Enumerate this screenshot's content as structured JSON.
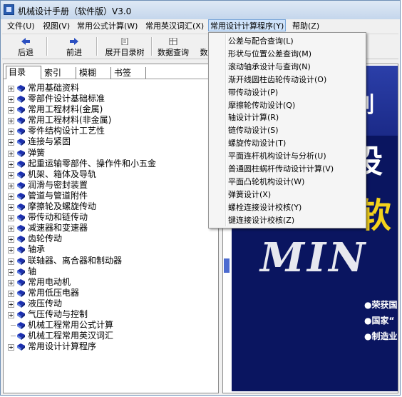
{
  "window": {
    "title": "机械设计手册（软件版）V3.0"
  },
  "menubar": {
    "items": [
      {
        "label": "文件(U)"
      },
      {
        "label": "视图(V)"
      },
      {
        "label": "常用公式计算(W)"
      },
      {
        "label": "常用英汉词汇(X)"
      },
      {
        "label": "常用设计计算程序(Y)"
      },
      {
        "label": "帮助(Z)"
      }
    ]
  },
  "toolbar": {
    "back_label": "后退",
    "forward_label": "前进",
    "expand_label": "展开目录树",
    "query_label": "数据查询",
    "more_label": "数"
  },
  "left_panel": {
    "tabs": [
      {
        "label": "目录"
      },
      {
        "label": "索引"
      },
      {
        "label": "模糊"
      },
      {
        "label": "书签"
      }
    ],
    "tree": [
      {
        "label": "常用基础资料",
        "expandable": true
      },
      {
        "label": "零部件设计基础标准",
        "expandable": true
      },
      {
        "label": "常用工程材料(金属)",
        "expandable": true
      },
      {
        "label": "常用工程材料(非金属)",
        "expandable": true
      },
      {
        "label": "零件结构设计工艺性",
        "expandable": true
      },
      {
        "label": "连接与紧固",
        "expandable": true
      },
      {
        "label": "弹簧",
        "expandable": true
      },
      {
        "label": "起重运输零部件、操作件和小五金",
        "expandable": true
      },
      {
        "label": "机架、箱体及导轨",
        "expandable": true
      },
      {
        "label": "润滑与密封装置",
        "expandable": true
      },
      {
        "label": "管道与管道附件",
        "expandable": true
      },
      {
        "label": "摩擦轮及螺旋传动",
        "expandable": true
      },
      {
        "label": "带传动和链传动",
        "expandable": true
      },
      {
        "label": "减速器和变速器",
        "expandable": true
      },
      {
        "label": "齿轮传动",
        "expandable": true
      },
      {
        "label": "轴承",
        "expandable": true
      },
      {
        "label": "联轴器、离合器和制动器",
        "expandable": true
      },
      {
        "label": "轴",
        "expandable": true
      },
      {
        "label": "常用电动机",
        "expandable": true
      },
      {
        "label": "常用低压电器",
        "expandable": true
      },
      {
        "label": "液压传动",
        "expandable": true
      },
      {
        "label": "气压传动与控制",
        "expandable": true
      },
      {
        "label": "机械工程常用公式计算",
        "expandable": false
      },
      {
        "label": "机械工程常用英汉词汇",
        "expandable": false
      },
      {
        "label": "常用设计计算程序",
        "expandable": true
      }
    ]
  },
  "dropdown": {
    "items": [
      {
        "label": "公差与配合查询(L)"
      },
      {
        "label": "形状与位置公差查询(M)"
      },
      {
        "label": "滚动轴承设计与查询(N)"
      },
      {
        "label": "渐开线圆柱齿轮传动设计(O)"
      },
      {
        "label": "带传动设计(P)"
      },
      {
        "label": "摩擦轮传动设计(Q)"
      },
      {
        "label": "轴设计计算(R)"
      },
      {
        "label": "链传动设计(S)"
      },
      {
        "label": "螺旋传动设计(T)"
      },
      {
        "label": "平面连杆机构设计与分析(U)"
      },
      {
        "label": "普通圆柱蜗杆传动设计计算(V)"
      },
      {
        "label": "平面凸轮机构设计(W)"
      },
      {
        "label": "弹簧设计(X)"
      },
      {
        "label": "螺栓连接设计校核(Y)"
      },
      {
        "label": "键连接设计校核(Z)"
      }
    ]
  },
  "cover": {
    "big_1": "设",
    "big_2": "软",
    "big_3": "MIN",
    "partial": "列",
    "bullets": [
      {
        "label": "●荣获国"
      },
      {
        "label": "●国家“"
      },
      {
        "label": "●制造业"
      }
    ]
  },
  "colors": {
    "tree_icon": "#1b2fb0",
    "menu_highlight": "#cfe3fa",
    "cover_bg": "#0a1560"
  }
}
